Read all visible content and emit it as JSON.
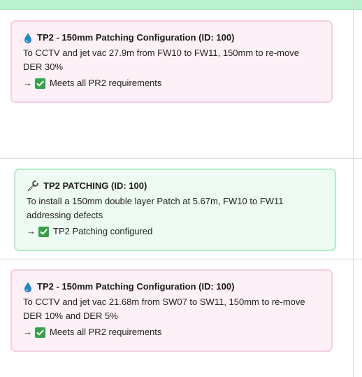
{
  "cards": [
    {
      "title": "TP2 - 150mm Patching Configuration (ID: 100)",
      "description": "To CCTV and jet vac 27.9m from FW10 to FW11, 150mm to re-move DER 30%",
      "arrow": "→",
      "status": "Meets all PR2 requirements",
      "icon": "water-drop-icon",
      "theme": "pink"
    },
    {
      "title": "TP2 PATCHING (ID: 100)",
      "description": "To install a 150mm double layer Patch at 5.67m, FW10 to FW11 addressing defects",
      "arrow": "→",
      "status": "TP2 Patching configured",
      "icon": "wrench-icon",
      "theme": "green"
    },
    {
      "title": "TP2 - 150mm Patching Configuration (ID: 100)",
      "description": "To CCTV and jet vac 21.68m from SW07 to SW11, 150mm to re-move DER 10% and DER 5%",
      "arrow": "→",
      "status": "Meets all PR2 requirements",
      "icon": "water-drop-icon",
      "theme": "pink"
    }
  ],
  "colors": {
    "header_band": "#b8f2cf",
    "pink_bg": "#fdf0f6",
    "pink_border": "#f3cfe0",
    "green_bg": "#edfbf2",
    "green_border": "#b6ecca",
    "check": "#34a24a",
    "drop": "#1e88c7"
  }
}
